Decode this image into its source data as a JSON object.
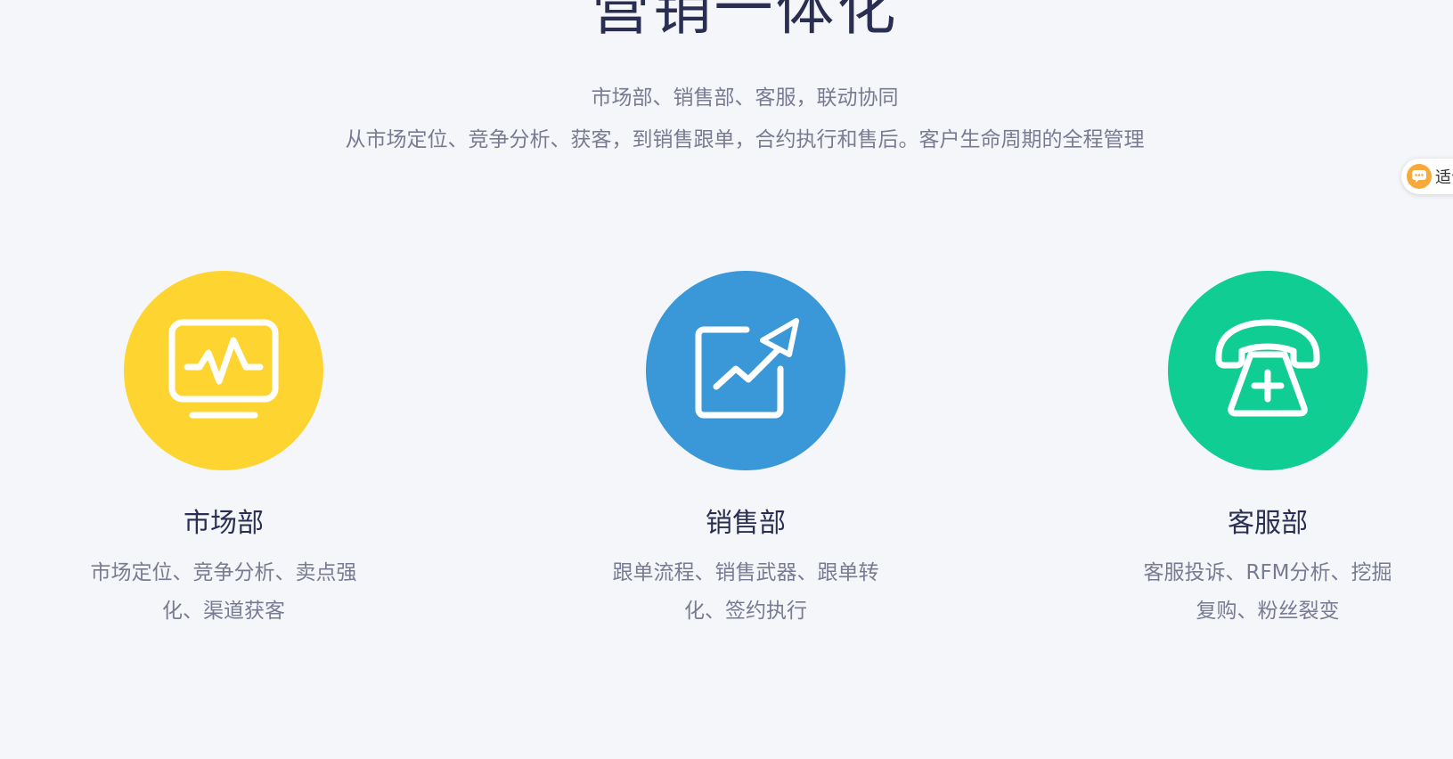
{
  "header": {
    "title": "营销一体化",
    "subtitle_line1": "市场部、销售部、客服，联动协同",
    "subtitle_line2": "从市场定位、竞争分析、获客，到销售跟单，合约执行和售后。客户生命周期的全程管理"
  },
  "chat_widget": {
    "label": "适合",
    "icon": "chat-bubble-icon",
    "color": "#f7a93b"
  },
  "departments": [
    {
      "title": "市场部",
      "desc": "市场定位、竞争分析、卖点强化、渠道获客",
      "icon": "monitor-pulse-icon",
      "color": "#fed530"
    },
    {
      "title": "销售部",
      "desc": "跟单流程、销售武器、跟单转化、签约执行",
      "icon": "growth-chart-icon",
      "color": "#3a97d8"
    },
    {
      "title": "客服部",
      "desc": "客服投诉、RFM分析、挖掘复购、粉丝裂变",
      "icon": "telephone-icon",
      "color": "#10cd93"
    }
  ]
}
